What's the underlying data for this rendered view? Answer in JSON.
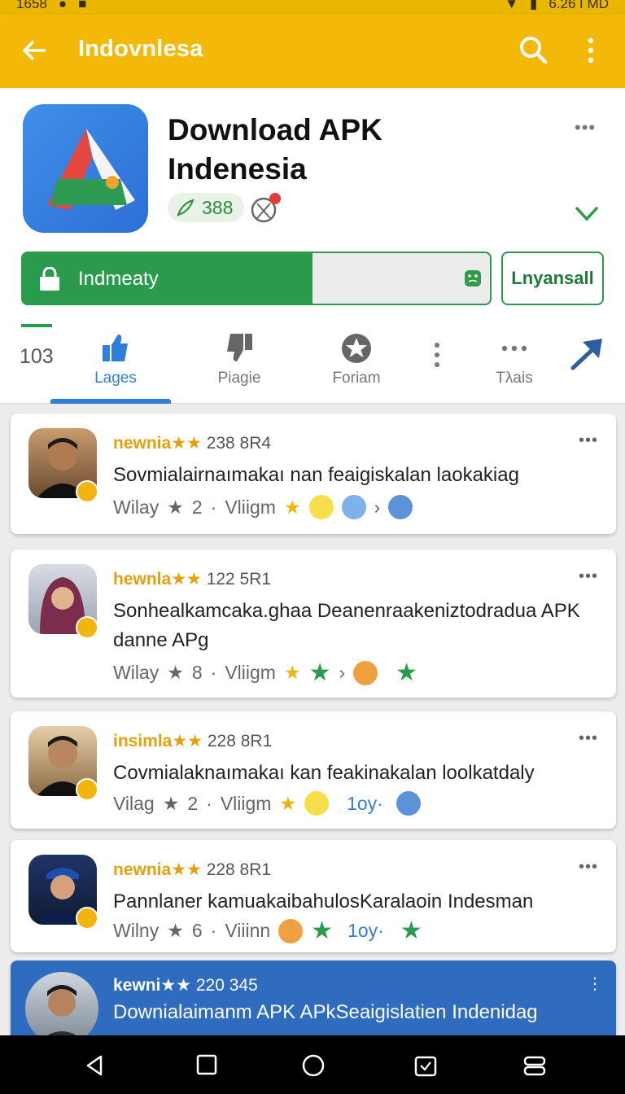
{
  "status_bar": {
    "time_left": "1658",
    "time_right": "6.26 ΓMD"
  },
  "app_bar": {
    "title": "Indovnlesa",
    "back_icon": "arrow-left-icon",
    "search_icon": "search-icon",
    "more_icon": "more-vertical-icon"
  },
  "app": {
    "title": "Download APK Indenesia",
    "rating": "388",
    "install_label": "Indmeaty",
    "install_progress": 0.62,
    "secondary_button": "Lnyansall"
  },
  "tabs": {
    "count": "103",
    "items": [
      {
        "label": "Lages",
        "icon": "thumbs-up-icon"
      },
      {
        "label": "Piagie",
        "icon": "thumbs-down-icon"
      },
      {
        "label": "Foriam",
        "icon": "star-badge-icon"
      },
      {
        "label": "Tλais",
        "icon": "more-horizontal-icon"
      }
    ]
  },
  "reviews": [
    {
      "name": "newnia",
      "stars": "★★",
      "meta": "238 8R4",
      "text": "Sovmialairnaımakaı nan feaigiskalan laokakiag",
      "tag1": "Wilay",
      "count": "2",
      "tag2": "Vliigm"
    },
    {
      "name": "hewnla",
      "stars": "★★",
      "meta": "122 5R1",
      "text": "Sonhealkamcaka.ghaa Deanenraakeniztodradua APK danne APg",
      "tag1": "Wilay",
      "count": "8",
      "tag2": "Vliigm"
    },
    {
      "name": "insimla",
      "stars": "★★",
      "meta": "228 8R1",
      "text": "Covmialaknaımakaı kan feakinakalan loolkatdaly",
      "tag1": "Vilag",
      "count": "2",
      "tag2": "Vliigm",
      "extra": "1oy·"
    },
    {
      "name": "newnia",
      "stars": "★★",
      "meta": "228 8R1",
      "text": "Pannlaner kamuakaibahulosKaralaoin Indesman",
      "tag1": "Wilny",
      "count": "6",
      "tag2": "Viiinn",
      "extra": "1oy·"
    },
    {
      "name": "kewni",
      "stars": "★★",
      "meta": "220 345",
      "text": "Downialaimanm APK APkSeaigislatien Indenidag"
    }
  ],
  "colors": {
    "app_bar": "#f4b808",
    "install_green": "#2a9a4c",
    "tab_active": "#2f7fd8",
    "highlight_card": "#2f6cc0"
  }
}
